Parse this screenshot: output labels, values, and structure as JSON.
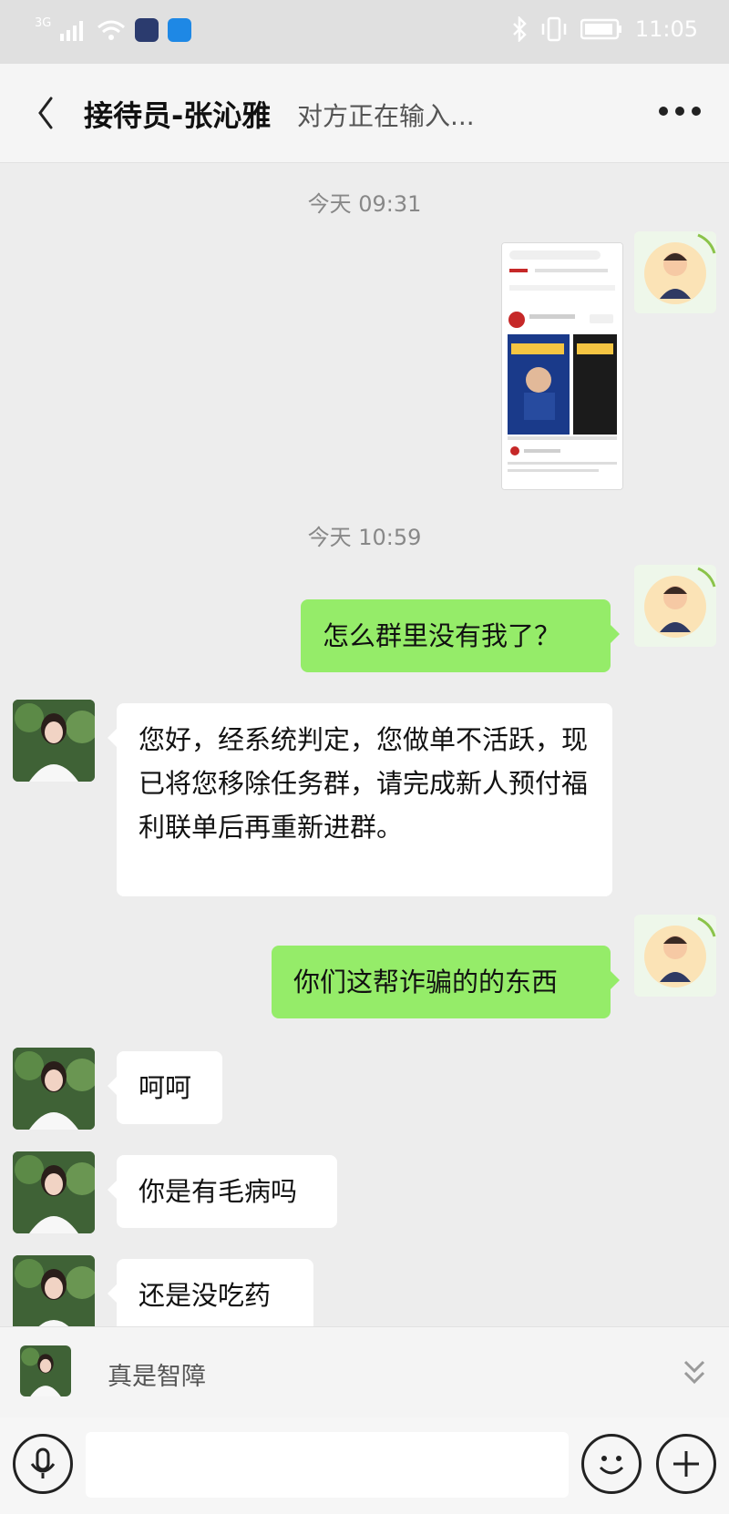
{
  "status_bar": {
    "network": "3G",
    "time": "11:05"
  },
  "header": {
    "back_label": "〈",
    "contact_name": "接待员-张沁雅",
    "typing_status": "对方正在输入..."
  },
  "messages": {
    "time1": "今天 09:31",
    "time2": "今天 10:59",
    "out1": "怎么群里没有我了？",
    "in1": "您好，经系统判定，您做单不活跃，现已将您移除任务群，请完成新人预付福利联单后再重新进群。",
    "out2": "你们这帮诈骗的的东西",
    "in2": "呵呵",
    "in3": "你是有毛病吗",
    "in4": "还是没吃药"
  },
  "preview": {
    "text": "真是智障"
  },
  "input": {
    "placeholder": ""
  },
  "colors": {
    "chat_bg": "#ededed",
    "outgoing_bubble": "#95ec69",
    "incoming_bubble": "#ffffff"
  }
}
